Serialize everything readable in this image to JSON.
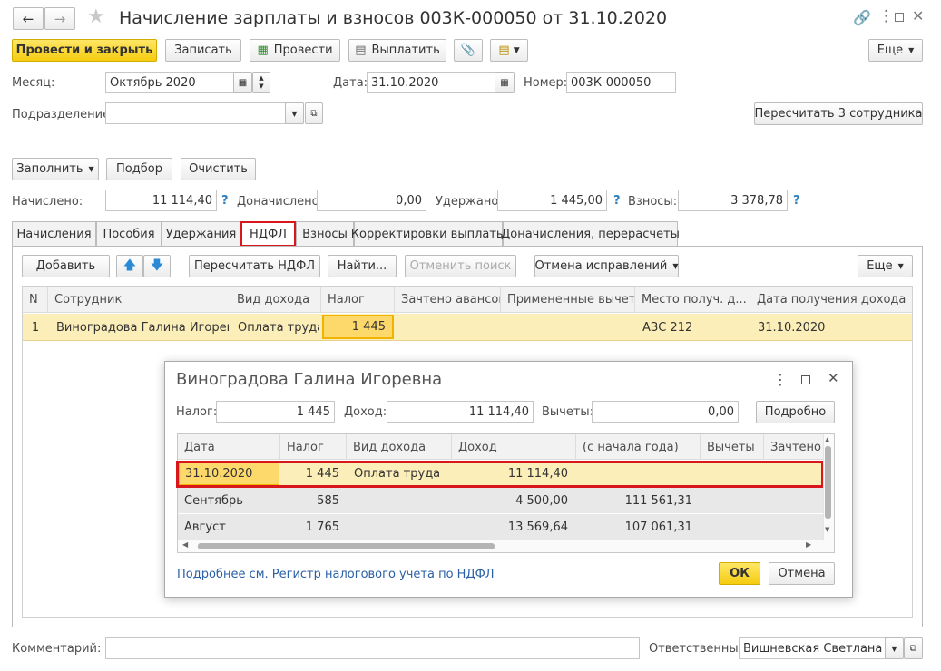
{
  "window": {
    "title": "Начисление зарплаты и взносов 003К-000050 от 31.10.2020"
  },
  "toolbar": {
    "post_close": "Провести и закрыть",
    "save": "Записать",
    "post": "Провести",
    "pay": "Выплатить",
    "more": "Еще"
  },
  "form": {
    "month_label": "Месяц:",
    "month_value": "Октябрь 2020",
    "date_label": "Дата:",
    "date_value": "31.10.2020",
    "number_label": "Номер:",
    "number_value": "003К-000050",
    "dept_label": "Подразделение:",
    "dept_value": "",
    "recalc_button": "Пересчитать 3 сотрудника",
    "fill_button": "Заполнить",
    "select_button": "Подбор",
    "clear_button": "Очистить",
    "accrued_label": "Начислено:",
    "accrued_value": "11 114,40",
    "extra_label": "Доначислено:",
    "extra_value": "0,00",
    "withheld_label": "Удержано:",
    "withheld_value": "1 445,00",
    "contrib_label": "Взносы:",
    "contrib_value": "3 378,78"
  },
  "tabs": [
    "Начисления",
    "Пособия",
    "Удержания",
    "НДФЛ",
    "Взносы",
    "Корректировки выплаты",
    "Доначисления, перерасчеты"
  ],
  "ndfl": {
    "add": "Добавить",
    "recalc": "Пересчитать НДФЛ",
    "find": "Найти...",
    "cancel_search": "Отменить поиск",
    "cancel_corr": "Отмена исправлений",
    "more": "Еще",
    "columns": [
      "N",
      "Сотрудник",
      "Вид дохода",
      "Налог",
      "Зачтено авансов",
      "Примененные вычеты",
      "Место получ. д...",
      "Дата получения дохода"
    ],
    "row": {
      "n": "1",
      "employee": "Виноградова Галина Игоревна",
      "income_type": "Оплата труда",
      "tax": "1 445",
      "advances": "",
      "deductions": "",
      "place": "АЗС 212",
      "date": "31.10.2020"
    }
  },
  "dialog": {
    "title": "Виноградова Галина Игоревна",
    "tax_label": "Налог:",
    "tax_value": "1 445",
    "income_label": "Доход:",
    "income_value": "11 114,40",
    "ded_label": "Вычеты:",
    "ded_value": "0,00",
    "detail_button": "Подробно",
    "columns": [
      "Дата",
      "Налог",
      "Вид дохода",
      "Доход",
      "(с начала года)",
      "Вычеты",
      "Зачтено а"
    ],
    "rows": [
      {
        "date": "31.10.2020",
        "tax": "1 445",
        "type": "Оплата труда",
        "income": "11 114,40",
        "ytd": "",
        "ded": "",
        "offset": ""
      },
      {
        "date": "Сентябрь",
        "tax": "585",
        "type": "",
        "income": "4 500,00",
        "ytd": "111 561,31",
        "ded": "",
        "offset": ""
      },
      {
        "date": "Август",
        "tax": "1 765",
        "type": "",
        "income": "13 569,64",
        "ytd": "107 061,31",
        "ded": "",
        "offset": ""
      }
    ],
    "link": "Подробнее см. Регистр налогового учета по НДФЛ",
    "ok": "ОК",
    "cancel": "Отмена"
  },
  "footer": {
    "comment_label": "Комментарий:",
    "comment_value": "",
    "resp_label": "Ответственный:",
    "resp_value": "Вишневская Светлана Ни"
  }
}
